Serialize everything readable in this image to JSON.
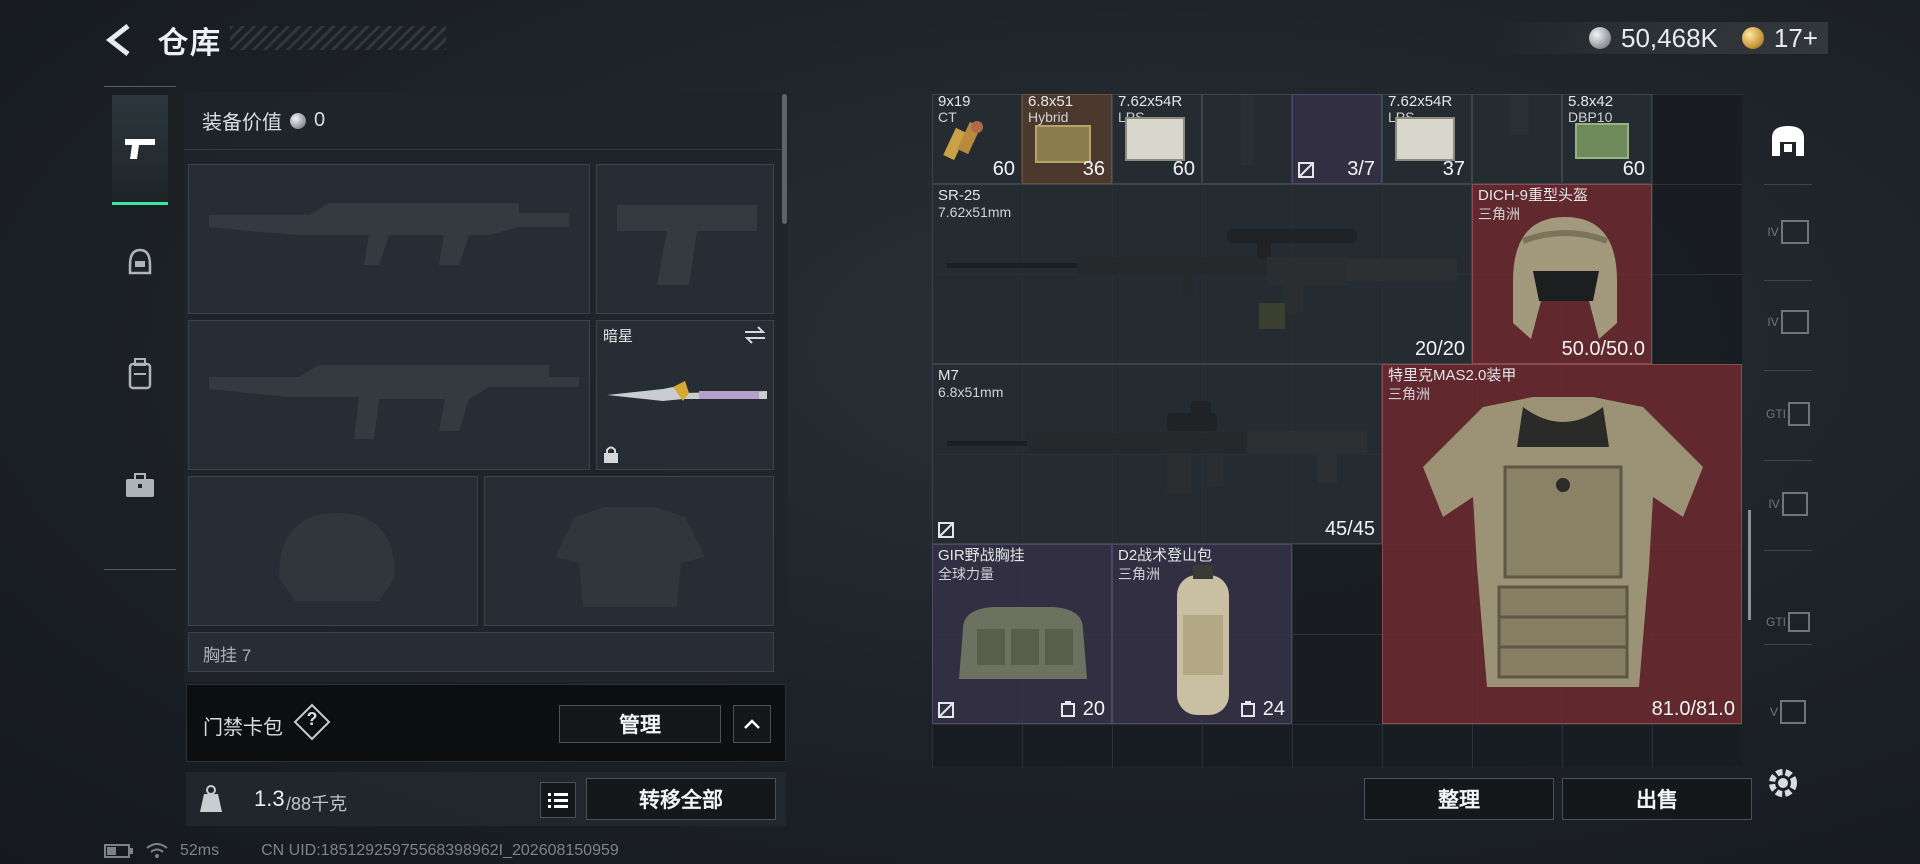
{
  "header": {
    "title": "仓库",
    "currency_silver": "50,468K",
    "currency_gold": "17+"
  },
  "equipment": {
    "value_label": "装备价值",
    "value_amount": "0",
    "melee_name": "暗星",
    "partial_label": "胸挂 7"
  },
  "access_card": {
    "label": "门禁卡包",
    "help": "?",
    "manage_label": "管理"
  },
  "weight": {
    "current": "1.3",
    "max": "/88千克",
    "transfer_all_label": "转移全部"
  },
  "status": {
    "ping": "52ms",
    "uid": "CN UID:18512925975568398962I_202608150959"
  },
  "inventory": {
    "ammo": [
      {
        "name": "9x19",
        "sub": "CT",
        "count": "60"
      },
      {
        "name": "6.8x51",
        "sub": "Hybrid",
        "count": "36"
      },
      {
        "name": "7.62x54R",
        "sub": "LPS",
        "count": "60"
      },
      {
        "name": "",
        "sub": "",
        "count": ""
      },
      {
        "name": "",
        "sub": "",
        "count": "3/7"
      },
      {
        "name": "7.62x54R",
        "sub": "LPS",
        "count": "37"
      },
      {
        "name": "",
        "sub": "",
        "count": ""
      },
      {
        "name": "5.8x42",
        "sub": "DBP10",
        "count": "60"
      }
    ],
    "sr25": {
      "name": "SR-25",
      "sub": "7.62x51mm",
      "count": "20/20"
    },
    "helmet": {
      "name": "DICH-9重型头盔",
      "sub": "三角洲",
      "count": "50.0/50.0"
    },
    "m7": {
      "name": "M7",
      "sub": "6.8x51mm",
      "count": "45/45"
    },
    "armor": {
      "name": "特里克MAS2.0装甲",
      "sub": "三角洲",
      "count": "81.0/81.0"
    },
    "chest_rig": {
      "name": "GIR野战胸挂",
      "sub": "全球力量",
      "count": "20"
    },
    "backpack": {
      "name": "D2战术登山包",
      "sub": "三角洲",
      "count": "24"
    }
  },
  "actions": {
    "sort_label": "整理",
    "sell_label": "出售"
  },
  "side_rail": [
    "IV",
    "IV",
    "GTI",
    "IV",
    "GTI",
    "V"
  ]
}
